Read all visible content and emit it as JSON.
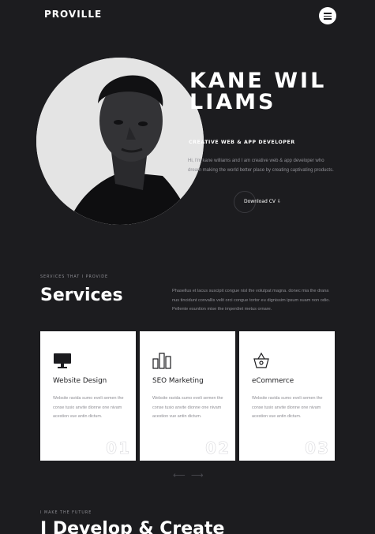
{
  "header": {
    "logo": "PROVILLE",
    "menu_icon": "hamburger-menu-icon"
  },
  "hero": {
    "name": "KANE WILLIAMS",
    "role": "CREATIVE WEB & APP DEVELOPER",
    "description": "Hi, I'm kane williams and I am creative web & app developer who dream making the world better place by creating captivating products.",
    "cta_label": "Download CV",
    "cta_icon": "download-icon",
    "photo": "portrait-photo"
  },
  "services": {
    "eyebrow": "SERVICES THAT I PROVIDE",
    "title": "Services",
    "description": "Phasellus et lacus suscipit congue nisl the volutpat magna. donec mia the drana nus tincidunt convallis velit orci congue tortor eu dignissim ipsum suam non odio. Pellente esuntion mise the imperdiet metus ornare.",
    "cards": [
      {
        "icon": "monitor-icon",
        "title": "Website Design",
        "description": "Website ravida sumo eveli semen the conse tusio anvite dionne one nivam acestion vue antin dictum.",
        "number": "01"
      },
      {
        "icon": "bar-chart-icon",
        "title": "SEO Marketing",
        "description": "Website ravida sumo eveli semen the conse tusio anvite dionne one nivam acestion vue antin dictum.",
        "number": "02"
      },
      {
        "icon": "basket-icon",
        "title": "eCommerce",
        "description": "Website ravida sumo eveli semen the conse tusio anvite dionne one nivam acestion vue antin dictum.",
        "number": "03"
      }
    ],
    "prev_arrow": "⟵",
    "next_arrow": "⟶"
  },
  "next_section": {
    "eyebrow": "I MAKE THE FUTURE",
    "title": "I Develop & Create"
  },
  "colors": {
    "background": "#1c1c1f",
    "card": "#ffffff",
    "muted_text": "#8e8e94"
  }
}
